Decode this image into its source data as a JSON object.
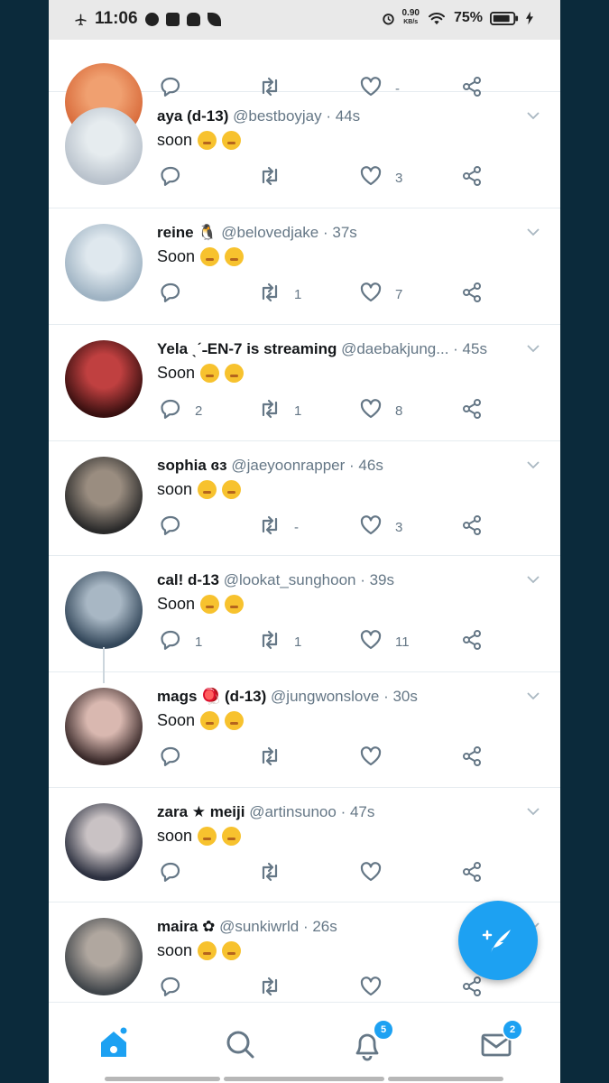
{
  "status_bar": {
    "time": "11:06",
    "net_speed": "0.90",
    "net_unit": "KB/s",
    "battery": "75%"
  },
  "tweets": [
    {
      "name": "",
      "handle": "",
      "time": "",
      "text": "",
      "replies": "",
      "retweets": "",
      "likes": "-"
    },
    {
      "name": "aya (d-13)",
      "handle": "@bestboyjay",
      "time": "· 44s",
      "text": "soon",
      "replies": "",
      "retweets": "",
      "likes": "3"
    },
    {
      "name": "reine 🐧",
      "handle": "@belovedjake",
      "time": "· 37s",
      "text": "Soon",
      "replies": "",
      "retweets": "1",
      "likes": "7"
    },
    {
      "name": "Yela ˎˊ˗EN-7 is streaming",
      "handle": "@daebakjung...",
      "time": "· 45s",
      "text": "Soon",
      "replies": "2",
      "retweets": "1",
      "likes": "8"
    },
    {
      "name": "sophia ɞɜ",
      "handle": "@jaeyoonrapper",
      "time": "· 46s",
      "text": "soon",
      "replies": "",
      "retweets": "-",
      "likes": "3"
    },
    {
      "name": "cal! d-13",
      "handle": "@lookat_sunghoon",
      "time": "· 39s",
      "text": "Soon",
      "replies": "1",
      "retweets": "1",
      "likes": "11"
    },
    {
      "name": "mags 🪀 (d-13)",
      "handle": "@jungwonslove",
      "time": "· 30s",
      "text": "Soon",
      "replies": "",
      "retweets": "",
      "likes": ""
    },
    {
      "name": "zara ★ meiji",
      "handle": "@artinsunoo",
      "time": "· 47s",
      "text": "soon",
      "replies": "",
      "retweets": "",
      "likes": ""
    },
    {
      "name": "maira ✿",
      "handle": "@sunkiwrld",
      "time": "· 26s",
      "text": "soon",
      "replies": "",
      "retweets": "",
      "likes": ""
    }
  ],
  "nav": {
    "notifications_badge": "5",
    "messages_badge": "2"
  },
  "colors": {
    "accent": "#1da1f2",
    "icon_gray": "#657786",
    "divider": "#e6ecf0",
    "outer_bg": "#0b2a3b"
  },
  "icons": {
    "reply": "reply-icon",
    "retweet": "retweet-icon",
    "like": "heart-icon",
    "share": "share-icon",
    "compose": "compose-feather-icon",
    "home": "home-icon",
    "search": "search-icon",
    "notifications": "bell-icon",
    "messages": "mail-icon"
  }
}
